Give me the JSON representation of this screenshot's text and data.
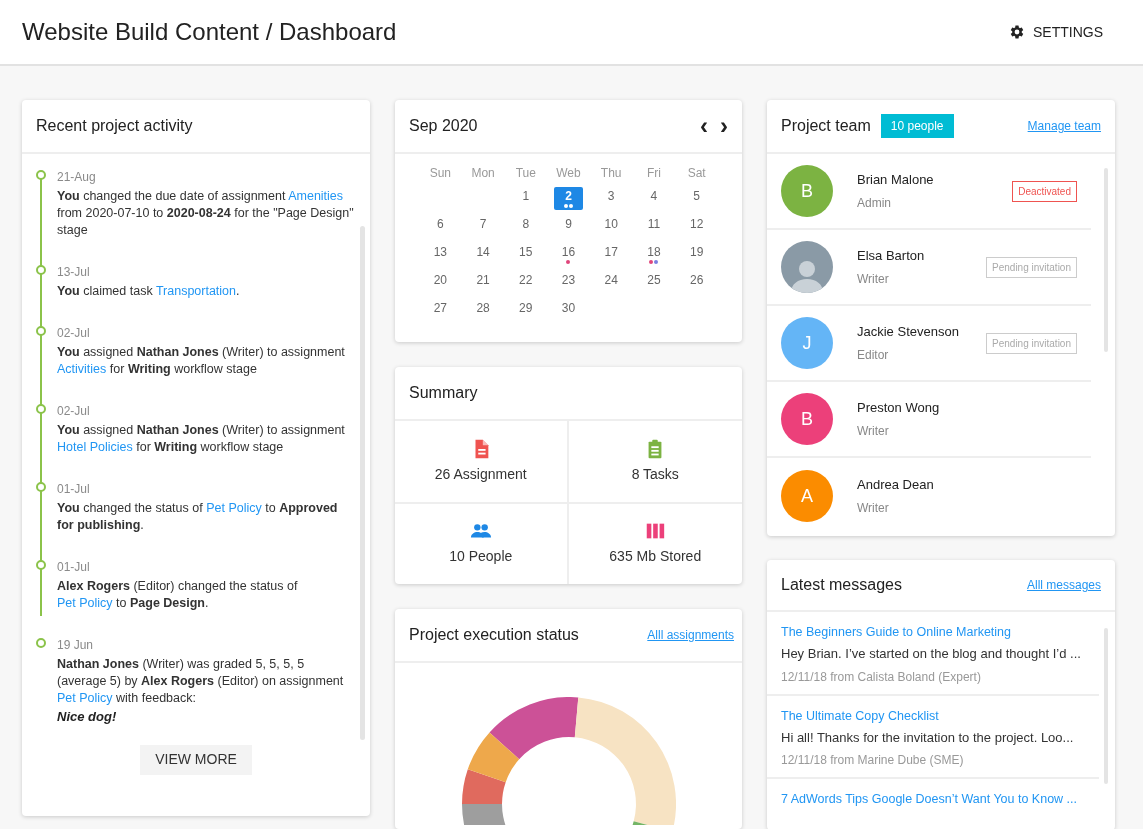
{
  "header": {
    "title": "Website Build Content / Dashboard",
    "settings_label": "SETTINGS"
  },
  "activity": {
    "title": "Recent project activity",
    "button": "VIEW MORE",
    "items": [
      {
        "date": "21-Aug",
        "parts": [
          {
            "kind": "text",
            "text": "**You** changed the due date of assignment "
          },
          {
            "kind": "link",
            "text": "Amenities"
          },
          {
            "kind": "text",
            "text": " from 2020-07-10 to **2020-08-24** for the \"Page Design\" stage"
          }
        ]
      },
      {
        "date": "13-Jul",
        "parts": [
          {
            "kind": "text",
            "text": "**You** claimed task "
          },
          {
            "kind": "link",
            "text": "Transportation"
          },
          {
            "kind": "text",
            "text": "."
          }
        ]
      },
      {
        "date": "02-Jul",
        "parts": [
          {
            "kind": "text",
            "text": "**You** assigned **Nathan Jones** (Writer) to assignment "
          },
          {
            "kind": "link",
            "text": "Activities"
          },
          {
            "kind": "text",
            "text": " for **Writing** workflow stage"
          }
        ]
      },
      {
        "date": "02-Jul",
        "parts": [
          {
            "kind": "text",
            "text": "**You** assigned **Nathan Jones** (Writer) to assignment "
          },
          {
            "kind": "link",
            "text": "Hotel Policies"
          },
          {
            "kind": "text",
            "text": " for **Writing** workflow stage"
          }
        ]
      },
      {
        "date": "01-Jul",
        "parts": [
          {
            "kind": "text",
            "text": "**You** changed the status of "
          },
          {
            "kind": "link",
            "text": "Pet Policy"
          },
          {
            "kind": "text",
            "text": " to **Approved for publishing**."
          }
        ]
      },
      {
        "date": "01-Jul",
        "parts": [
          {
            "kind": "text",
            "text": "**Alex Rogers** (Editor) changed the status of "
          },
          {
            "kind": "link",
            "text": "Pet Policy"
          },
          {
            "kind": "text",
            "text": " to **Page Design**."
          }
        ]
      },
      {
        "date": "19 Jun",
        "parts": [
          {
            "kind": "text",
            "text": "**Nathan Jones** (Writer) was graded 5, 5, 5, 5 (average 5) by **Alex Rogers** (Editor) on assignment "
          },
          {
            "kind": "link",
            "text": "Pet Policy"
          },
          {
            "kind": "text",
            "text": " with feedback:"
          }
        ],
        "feedback": "Nice dog!"
      }
    ]
  },
  "calendar": {
    "title": "Sep 2020",
    "prev": "‹",
    "next": "›",
    "weekdays": [
      "Sun",
      "Mon",
      "Tue",
      "Web",
      "Thu",
      "Fri",
      "Sat"
    ],
    "weeks": [
      [
        {
          "kind": "blank"
        },
        {
          "kind": "blank"
        },
        {
          "kind": "day",
          "text": "1",
          "selected": false
        },
        {
          "kind": "day",
          "text": "2",
          "selected": true,
          "dots": [
            {
              "color": "#ffffff"
            },
            {
              "color": "#ffffff"
            }
          ]
        },
        {
          "kind": "day",
          "text": "3",
          "selected": false
        },
        {
          "kind": "day",
          "text": "4",
          "selected": false
        },
        {
          "kind": "day",
          "text": "5",
          "selected": false
        }
      ],
      [
        {
          "kind": "day",
          "text": "6",
          "selected": false
        },
        {
          "kind": "day",
          "text": "7",
          "selected": false
        },
        {
          "kind": "day",
          "text": "8",
          "selected": false
        },
        {
          "kind": "day",
          "text": "9",
          "selected": false
        },
        {
          "kind": "day",
          "text": "10",
          "selected": false
        },
        {
          "kind": "day",
          "text": "11",
          "selected": false
        },
        {
          "kind": "day",
          "text": "12",
          "selected": false
        }
      ],
      [
        {
          "kind": "day",
          "text": "13",
          "selected": false
        },
        {
          "kind": "day",
          "text": "14",
          "selected": false
        },
        {
          "kind": "day",
          "text": "15",
          "selected": false
        },
        {
          "kind": "day",
          "text": "16",
          "selected": false,
          "dots": [
            {
              "color": "#e0457b"
            }
          ]
        },
        {
          "kind": "day",
          "text": "17",
          "selected": false
        },
        {
          "kind": "day",
          "text": "18",
          "selected": false,
          "dots": [
            {
              "color": "#e0457b"
            },
            {
              "color": "#7b7fe0"
            }
          ]
        },
        {
          "kind": "day",
          "text": "19",
          "selected": false
        }
      ],
      [
        {
          "kind": "day",
          "text": "20",
          "selected": false
        },
        {
          "kind": "day",
          "text": "21",
          "selected": false
        },
        {
          "kind": "day",
          "text": "22",
          "selected": false
        },
        {
          "kind": "day",
          "text": "23",
          "selected": false
        },
        {
          "kind": "day",
          "text": "24",
          "selected": false
        },
        {
          "kind": "day",
          "text": "25",
          "selected": false
        },
        {
          "kind": "day",
          "text": "26",
          "selected": false
        }
      ],
      [
        {
          "kind": "day",
          "text": "27",
          "selected": false
        },
        {
          "kind": "day",
          "text": "28",
          "selected": false
        },
        {
          "kind": "day",
          "text": "29",
          "selected": false
        },
        {
          "kind": "day",
          "text": "30",
          "selected": false
        },
        {
          "kind": "blank"
        },
        {
          "kind": "blank"
        },
        {
          "kind": "blank"
        }
      ]
    ]
  },
  "summary": {
    "title": "Summary",
    "stats": [
      {
        "kind": "document",
        "label": "26 Assignment",
        "color": "#ef5350"
      },
      {
        "kind": "clipboard",
        "label": "8 Tasks",
        "color": "#7cb342"
      },
      {
        "kind": "people",
        "label": "10 People",
        "color": "#1e88e5"
      },
      {
        "kind": "storage",
        "label": "635 Mb Stored",
        "color": "#ec407a"
      }
    ]
  },
  "execution": {
    "title": "Project execution status",
    "link": "Alll assignments"
  },
  "team": {
    "title": "Project team",
    "count": "10 people",
    "link": "Manage team",
    "members": [
      {
        "kind": "initial",
        "initial": "B",
        "color": "#7cb342",
        "name": "Brian Malone",
        "role": "Admin",
        "badge": {
          "kind": "deactivated",
          "text": "Deactivated"
        }
      },
      {
        "kind": "photo",
        "name": "Elsa Barton",
        "role": "Writer",
        "badge": {
          "kind": "pending",
          "text": "Pending invitation"
        }
      },
      {
        "kind": "initial",
        "initial": "J",
        "color": "#64b5f6",
        "name": "Jackie Stevenson",
        "role": "Editor",
        "badge": {
          "kind": "pending",
          "text": "Pending invitation"
        }
      },
      {
        "kind": "initial",
        "initial": "B",
        "color": "#ec407a",
        "name": "Preston Wong",
        "role": "Writer"
      },
      {
        "kind": "initial",
        "initial": "A",
        "color": "#fb8c00",
        "name": "Andrea Dean",
        "role": "Writer"
      }
    ]
  },
  "messages": {
    "title": "Latest messages",
    "link": "Alll messages",
    "items": [
      {
        "subject": "The Beginners Guide to Online Marketing",
        "preview": "Hey Brian. I’ve started on the blog and thought I’d ...",
        "meta": "12/11/18 from Calista Boland (Expert)"
      },
      {
        "subject": "The Ultimate Copy Checklist",
        "preview": "Hi all! Thanks for the invitation to the project. Loo...",
        "meta": "12/11/18 from Marine Dube (SME)"
      },
      {
        "subject": "7 AdWords Tips Google Doesn’t Want You to Know ..."
      }
    ]
  }
}
